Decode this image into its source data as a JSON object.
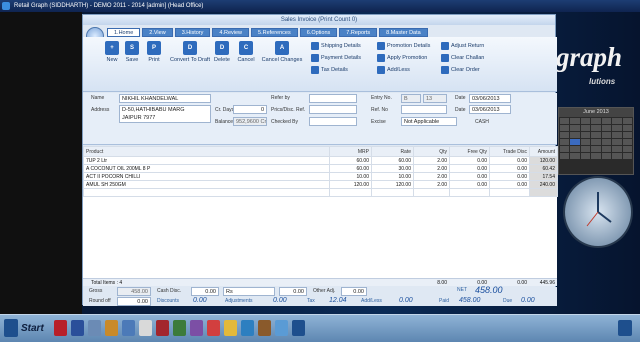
{
  "os_title": "Retail Graph (SIDDHARTH) - DEMO 2011 - 2014 [admin] (Head Office)",
  "window_title": "Sales Invoice   (Print Count 0)",
  "brand": {
    "main": "graph",
    "sub": "lutions"
  },
  "ribbon_tabs": [
    "1.Home",
    "2.View",
    "3.History",
    "4.Review",
    "5.References",
    "6.Options",
    "7.Reports",
    "8.Master Data"
  ],
  "toolbar": {
    "buttons": [
      "New",
      "Save",
      "Print",
      "Convert To Draft",
      "Delete",
      "Cancel",
      "Cancel Changes"
    ],
    "col1": [
      "Shipping Details",
      "Payment Details",
      "Tax Details"
    ],
    "col2": [
      "Promotion Details",
      "Apply Promotion",
      "Add/Less"
    ],
    "col3": [
      "Adjust Return",
      "Clear Challan",
      "Clear Order"
    ]
  },
  "form": {
    "name_label": "Name",
    "name_value": "NIKHIL KHANDELWAL",
    "address_label": "Address",
    "address_line1": "D-50,HATHIBABU MARG",
    "address_line2": "JAIPUR 7977",
    "refer_label": "Refer by",
    "prics_label": "Prics/Disc. Ref.",
    "checked_label": "Checked By",
    "crdays_label": "Cr. Days",
    "crdays_value": "0",
    "balance_label": "Balance",
    "balance_value": "952,9600 Cr",
    "entry_label": "Entry No.",
    "entry_prefix": "B",
    "entry_value": "13",
    "ref_label": "Ref. No",
    "excise_label": "Excise",
    "excise_value": "Not Applicable",
    "date_label": "Date",
    "date_value": "03/06/2013",
    "date2_label": "Date",
    "date2_value": "03/06/2013",
    "cash_label": "CASH"
  },
  "grid": {
    "headers": [
      "Product",
      "MRP",
      "Rate",
      "Qty",
      "Free Qty",
      "Trade Disc",
      "Amount"
    ],
    "rows": [
      [
        "7UP 2 Ltr",
        "60.00",
        "60.00",
        "2.00",
        "0.00",
        "0.00",
        "120.00"
      ],
      [
        "A COCONUT OIL 200ML 8 P",
        "60.00",
        "30.00",
        "2.00",
        "0.00",
        "0.00",
        "60.42"
      ],
      [
        "ACT II POCORN CHILLI",
        "10.00",
        "10.00",
        "2.00",
        "0.00",
        "0.00",
        "17.54"
      ],
      [
        "AMUL SH 250GM",
        "120.00",
        "120.00",
        "2.00",
        "0.00",
        "0.00",
        "240.00"
      ]
    ],
    "total_items_label": "Total Items : 4",
    "total_qty": "8.00",
    "total_free": "0.00",
    "total_disc": "0.00",
    "total_amount": "445.96"
  },
  "footer": {
    "gross_label": "Gross",
    "gross_value": "458.00",
    "roundoff_label": "Round off",
    "roundoff_value": "0.00",
    "cashdisc_label": "Cash Disc.",
    "cashdisc_value": "0.00",
    "cashdisc_unit": "Rs",
    "cashdisc_amt": "0.00",
    "otheradj_label": "Other Adj.",
    "otheradj_value": "0.00",
    "discounts_label": "Discounts",
    "discounts_value": "0.00",
    "adjustments_label": "Adjustments",
    "adjustments_value": "0.00",
    "tax_label": "Tax",
    "tax_value": "12.04",
    "addless_label": "Add/Less",
    "addless_value": "0.00",
    "net_label": "NET",
    "net_value": "458.00",
    "paid_label": "Paid",
    "paid_value": "458.00",
    "due_label": "Due",
    "due_value": "0.00"
  },
  "calendar": {
    "month": "June 2013"
  },
  "taskbar": {
    "start_label": "Start"
  },
  "colors": {
    "accent": "#2e6bbd",
    "desktop": "#0a1a38",
    "window_bg": "#dfe8f3"
  }
}
